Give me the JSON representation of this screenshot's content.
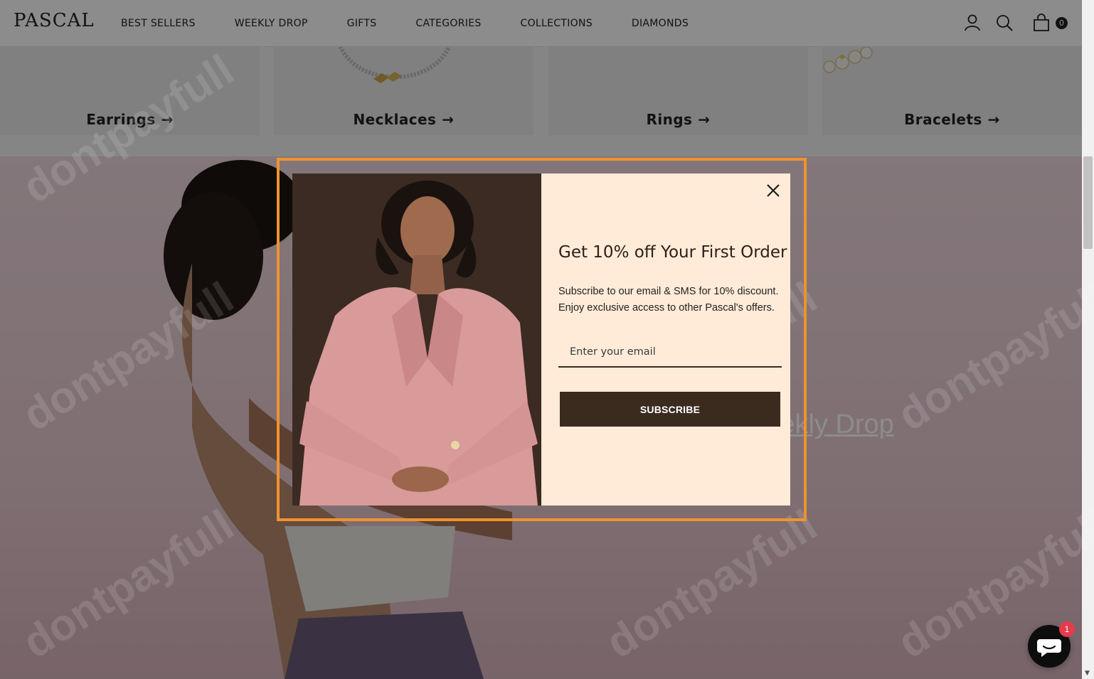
{
  "header": {
    "logo": "PASCAL",
    "nav": [
      {
        "label": "BEST SELLERS"
      },
      {
        "label": "WEEKLY DROP"
      },
      {
        "label": "GIFTS"
      },
      {
        "label": "CATEGORIES"
      },
      {
        "label": "COLLECTIONS"
      },
      {
        "label": "DIAMONDS"
      }
    ],
    "icons": [
      "account-icon",
      "search-icon",
      "cart-icon"
    ],
    "cart_count": "0"
  },
  "categories": [
    {
      "label": "Earrings",
      "arrow": "→"
    },
    {
      "label": "Necklaces",
      "arrow": "→"
    },
    {
      "label": "Rings",
      "arrow": "→"
    },
    {
      "label": "Bracelets",
      "arrow": "→"
    }
  ],
  "hero": {
    "link_text": "Weekly Drop"
  },
  "watermark": "dontpayfull",
  "popup": {
    "title": "Get 10% off Your First Order",
    "description_line1": "Subscribe to our email & SMS for 10% discount.",
    "description_line2": "Enjoy exclusive access to other Pascal's offers.",
    "email_placeholder": "Enter your email",
    "subscribe_label": "SUBSCRIBE",
    "close_icon": "close-icon"
  },
  "chat": {
    "badge_count": "1",
    "icon": "chat-icon"
  },
  "colors": {
    "accent_frame": "#f0922f",
    "popup_bg": "#ffebd8",
    "button_bg": "#3b2a1e",
    "chat_badge": "#e63a4d"
  }
}
